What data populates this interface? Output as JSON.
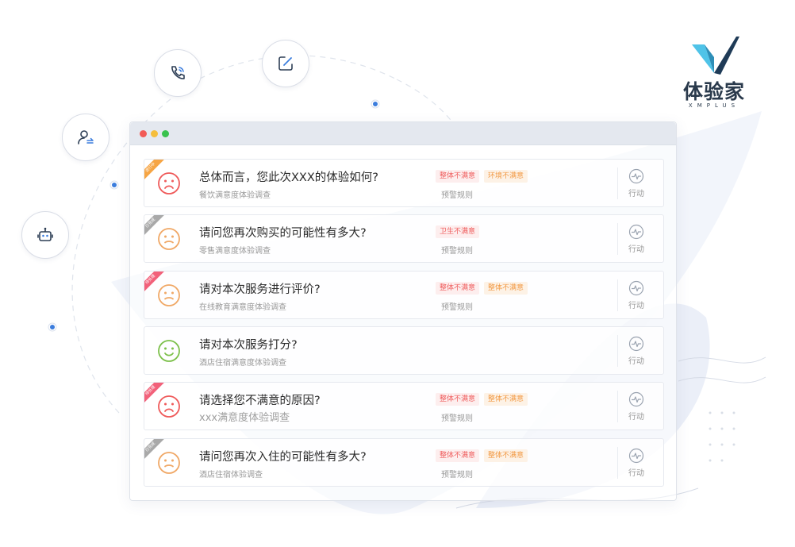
{
  "brand": {
    "name": "体验家",
    "sub": "XMPLUS"
  },
  "colors": {
    "accent": "#3b7ddd",
    "alert_red": "#ef5f5f",
    "alert_orange": "#f29a45",
    "happy_green": "#7cc04a"
  },
  "orbit_icons": [
    "phone-call-icon",
    "edit-icon",
    "user-transfer-icon",
    "robot-icon"
  ],
  "window": {
    "dots": [
      "red",
      "yellow",
      "green"
    ]
  },
  "action_label": "行动",
  "rule_label": "预警规则",
  "items": [
    {
      "status": "进行中",
      "ribbon": "orange",
      "face": "sad",
      "title": "总体而言，您此次XXX的体验如何?",
      "subtitle": "餐饮满意度体验调查",
      "tags": [
        {
          "text": "整体不满意",
          "style": "red"
        },
        {
          "text": "环境不满意",
          "style": "orange"
        }
      ],
      "rule": "预警规则",
      "action": "行动"
    },
    {
      "status": "已完成",
      "ribbon": "gray",
      "face": "neutral",
      "title": "请问您再次购买的可能性有多大?",
      "subtitle": "零售满意度体验调查",
      "tags": [
        {
          "text": "卫生不满意",
          "style": "red"
        }
      ],
      "rule": "预警规则",
      "action": "行动"
    },
    {
      "status": "待处理",
      "ribbon": "pink",
      "face": "neutral",
      "title": "请对本次服务进行评价?",
      "subtitle": "在线教育满意度体验调查",
      "tags": [
        {
          "text": "整体不满意",
          "style": "red"
        },
        {
          "text": "整体不满意",
          "style": "orange"
        }
      ],
      "rule": "预警规则",
      "action": "行动"
    },
    {
      "status": "",
      "ribbon": "",
      "face": "happy",
      "title": "请对本次服务打分?",
      "subtitle": "酒店住宿满意度体验调查",
      "tags": [],
      "rule": "",
      "action": "行动"
    },
    {
      "status": "待处理",
      "ribbon": "pink",
      "face": "sad",
      "title": "请选择您不满意的原因?",
      "subtitle": "xxx满意度体验调查",
      "tags": [
        {
          "text": "整体不满意",
          "style": "red"
        },
        {
          "text": "整体不满意",
          "style": "orange"
        }
      ],
      "rule": "预警规则",
      "action": "行动"
    },
    {
      "status": "已完成",
      "ribbon": "gray",
      "face": "neutral",
      "title": "请问您再次入住的可能性有多大?",
      "subtitle": "酒店住宿体验调查",
      "tags": [
        {
          "text": "整体不满意",
          "style": "red"
        },
        {
          "text": "整体不满意",
          "style": "orange"
        }
      ],
      "rule": "预警规则",
      "action": "行动"
    }
  ]
}
